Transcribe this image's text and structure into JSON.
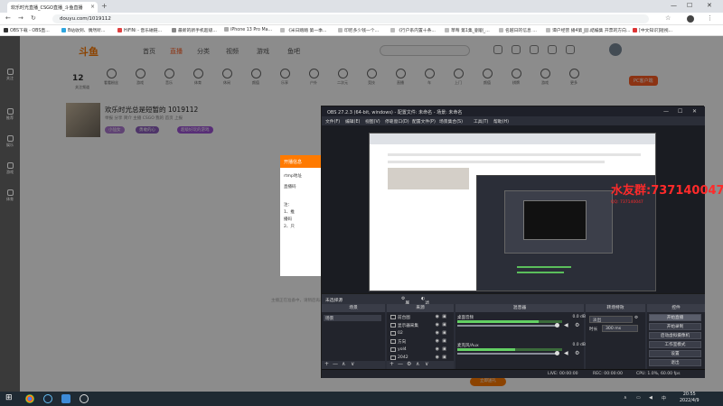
{
  "browser": {
    "tab_title": "欢乐时光直播_CSGO直播_斗鱼直播",
    "tab_close": "×",
    "new_tab": "+",
    "min": "—",
    "max": "☐",
    "close": "✕",
    "url": "douyu.com/1019112",
    "bookmarks": [
      "OBS下载 - OBS直...",
      "B站收到、偶然听...",
      "HiFiNi - 音乐磁链...",
      "最新的新手机超级...",
      "iPhone 13 Pro Ma...",
      "《米日踏踏 第一季...",
      "印尼多少钱一个...",
      "《行户系内置十条...",
      "草莓 第1集_剧剧_...",
      "名越日的信息 ...",
      "谭户经营 播4第_剧...",
      "结编集 开票的方向...",
      "[中文知识]短视..."
    ]
  },
  "site": {
    "logo": "斗鱼",
    "nav": [
      "首页",
      "直播",
      "分类",
      "视频",
      "游戏",
      "鱼吧"
    ],
    "follow_count": "12",
    "categories": [
      "关注频道",
      "看看粉丝",
      "游戏",
      "音乐",
      "体育",
      "休闲",
      "颜值",
      "乐享",
      "户外",
      "二次元",
      "竞技",
      "直播",
      "车",
      "上门",
      "颜值",
      "棋牌",
      "游戏",
      "更多"
    ],
    "pc_client": "PC客户端",
    "room_title": "欢乐时光总是短暂的 1019112",
    "room_meta": "举报  分享  简介  主播  CSGO  我的  首页  上报",
    "tags": [
      "小仙女",
      "勇敢的心",
      "超级好玩的游戏"
    ],
    "dialog_header": "开播信息",
    "dialog_lines": [
      "rtmp地址",
      "直播码",
      "注：",
      "1、推",
      "播码",
      "2、只"
    ],
    "bottom_text": "主播正在准备中，请稍后再来看看吧！",
    "gift": "立即送礼",
    "sidebar": [
      "关注",
      "推荐",
      "娱乐",
      "游戏",
      "体育"
    ]
  },
  "obs": {
    "title": "OBS 27.2.3 (64-bit, windows) - 配置文件: 未命名 - 场景: 未命名",
    "menu": [
      "文件(F)",
      "编辑(E)",
      "视图(V)",
      "停靠窗口(D)",
      "配置文件(P)",
      "场景集合(S)",
      "工具(T)",
      "帮助(H)"
    ],
    "overlay_qq": "水友群:737140047",
    "overlay_small": "QQ: 737140047",
    "no_source": "未选择源",
    "props": "属性",
    "filters": "滤镜",
    "docks": [
      "场景",
      "来源",
      "混音器",
      "转场特效",
      "控件"
    ],
    "scene": "场景",
    "sources": [
      "前台图",
      "显示器采集",
      "02",
      "方向",
      "yol4",
      "2042"
    ],
    "mixer": [
      {
        "name": "桌面音频",
        "db": "0.0 dB",
        "level": 0.78
      },
      {
        "name": "麦克风/Aux",
        "db": "0.0 dB",
        "level": 0.55
      }
    ],
    "transition": "淡出",
    "duration_label": "时长",
    "duration": "300 ms",
    "controls": [
      "开始直播",
      "开始录制",
      "启动虚拟摄像机",
      "工作室模式",
      "设置",
      "退出"
    ],
    "status": [
      "LIVE: 00:00:00",
      "REC: 00:00:00",
      "CPU: 1.0%, 60.00 fps"
    ],
    "add": "+",
    "remove": "—",
    "up": "∧",
    "down": "∨"
  },
  "taskbar": {
    "time": "20:55",
    "date": "2022/4/9",
    "lang": "中"
  },
  "colors": {
    "accent": "#ff7a00",
    "obs_bg": "#2b2e38",
    "overlay_red": "#ff2a2a",
    "meter_green": "#63d063"
  }
}
